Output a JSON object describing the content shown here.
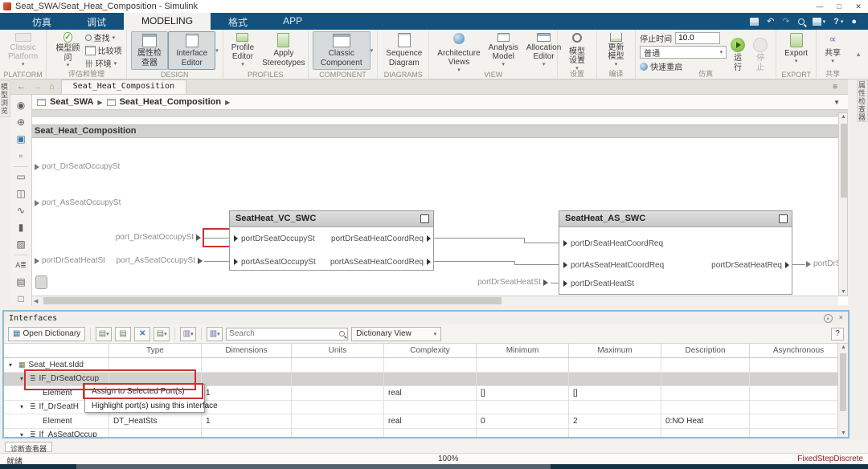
{
  "titlebar": {
    "title": "Seat_SWA/Seat_Heat_Composition - Simulink",
    "minimize_icon": "—",
    "maximize_icon": "□",
    "close_icon": "✕"
  },
  "ribbon": {
    "tabs": [
      {
        "label": "仿真"
      },
      {
        "label": "调试"
      },
      {
        "label": "MODELING"
      },
      {
        "label": "格式"
      },
      {
        "label": "APP"
      }
    ],
    "quick": {
      "undo": "↶",
      "redo": "↷",
      "help": "?",
      "account": "●"
    }
  },
  "toolstrip": {
    "platform": {
      "button": "Classic Platform",
      "label": "PLATFORM"
    },
    "evaluate": {
      "advisor": "模型顾问",
      "find": "查找",
      "compare": "比较项",
      "env": "环境",
      "label": "评估和管理"
    },
    "design": {
      "inspector": "属性检查器",
      "ieditor": "Interface Editor",
      "label": "DESIGN"
    },
    "profiles": {
      "peditor": "Profile Editor",
      "apply": "Apply Stereotypes",
      "label": "PROFILES"
    },
    "component": {
      "classic": "Classic Component",
      "label": "COMPONENT"
    },
    "diagrams": {
      "sequence": "Sequence Diagram",
      "label": "DIAGRAMS"
    },
    "view": {
      "arch": "Architecture Views",
      "analysis": "Analysis Model",
      "alloc": "Allocation Editor",
      "label": "VIEW"
    },
    "settings": {
      "model": "模型设置",
      "label": "设置"
    },
    "compile": {
      "update": "更新模型",
      "label": "编译"
    },
    "sim": {
      "stoptime_label": "停止时间",
      "stoptime": "10.0",
      "mode": "普通",
      "fast": "快速重启",
      "run": "运行",
      "stop": "停止",
      "label": "仿真"
    },
    "export": {
      "export": "Export",
      "label": "EXPORT"
    },
    "share": {
      "share": "共享",
      "label": "共享"
    }
  },
  "nav": {
    "doc_tab": "Seat_Heat_Composition",
    "back": "←",
    "forward": "→",
    "up": "⌂",
    "burger": "≡",
    "crumbs": [
      {
        "label": "Seat_SWA"
      },
      {
        "label": "Seat_Heat_Composition"
      }
    ],
    "sep": "▶",
    "dropdown": "▼"
  },
  "rails": {
    "left_label": "模型浏览器",
    "right_label": "属性检查器",
    "palette": [
      {
        "glyph": "◉"
      },
      {
        "glyph": "⊕"
      },
      {
        "glyph": "▣"
      },
      {
        "glyph": "▫"
      },
      {
        "glyph": "▭"
      },
      {
        "glyph": "◫"
      },
      {
        "glyph": "∿"
      },
      {
        "glyph": "▮"
      },
      {
        "glyph": "▨"
      },
      {
        "glyph": "A≣"
      },
      {
        "glyph": "▤"
      },
      {
        "glyph": "□"
      }
    ]
  },
  "canvas": {
    "frame_title": "Seat_Heat_Composition",
    "ext_in_1": "port_DrSeatOccupySt",
    "ext_in_2": "port_AsSeatOccupySt",
    "ext_in_3": "portDrSeatHeatSt",
    "link_dr": "port_DrSeatOccupySt",
    "link_as": "port_AsSeatOccupySt",
    "link_heatst": "portDrSeatHeatSt",
    "ext_out": "portDrSeatHeatRe",
    "vc": {
      "title": "SeatHeat_VC_SWC",
      "in1": "portDrSeatOccupySt",
      "in2": "portAsSeatOccupySt",
      "out1": "portDrSeatHeatCoordReq",
      "out2": "portAsSeatHeatCoordReq"
    },
    "as": {
      "title": "SeatHeat_AS_SWC",
      "in1": "portDrSeatHeatCoordReq",
      "in2": "portAsSeatHeatCoordReq",
      "in3": "portDrSeatHeatSt",
      "out1": "portDrSeatHeatReq"
    }
  },
  "interfaces": {
    "title": "Interfaces",
    "open_dictionary": "Open Dictionary",
    "search_placeholder": "Search",
    "view": "Dictionary View",
    "help": "?",
    "columns": [
      "Type",
      "Dimensions",
      "Units",
      "Complexity",
      "Minimum",
      "Maximum",
      "Description",
      "Asynchronous"
    ],
    "rows": [
      {
        "exp": "▾",
        "name": "Seat_Heat.sldd",
        "type": "",
        "dims": "",
        "units": "",
        "cplx": "",
        "min": "",
        "max": "",
        "desc": "",
        "async": ""
      },
      {
        "exp": "▾",
        "name": "IF_DrSeatOccup",
        "type": "",
        "dims": "",
        "units": "",
        "cplx": "",
        "min": "",
        "max": "",
        "desc": "",
        "async": ""
      },
      {
        "exp": "",
        "name": "Element",
        "type": "",
        "dims": "1",
        "units": "",
        "cplx": "real",
        "min": "[]",
        "max": "[]",
        "desc": "",
        "async": ""
      },
      {
        "exp": "▾",
        "name": "If_DrSeatH",
        "type": "",
        "dims": "",
        "units": "",
        "cplx": "",
        "min": "",
        "max": "",
        "desc": "",
        "async": ""
      },
      {
        "exp": "",
        "name": "Element",
        "type": "DT_HeatSts",
        "dims": "1",
        "units": "",
        "cplx": "real",
        "min": "0",
        "max": "2",
        "desc": "0:NO Heat",
        "async": ""
      },
      {
        "exp": "▾",
        "name": "If_AsSeatOccup",
        "type": "",
        "dims": "",
        "units": "",
        "cplx": "",
        "min": "",
        "max": "",
        "desc": "",
        "async": ""
      }
    ],
    "menu": {
      "item1": "Assign to Selected Port(s)",
      "item2": "Highlight port(s) using this interface"
    }
  },
  "status": {
    "diagnostic": "诊断查看器",
    "ready": "就绪",
    "zoom": "100%",
    "solver": "FixedStepDiscrete"
  }
}
